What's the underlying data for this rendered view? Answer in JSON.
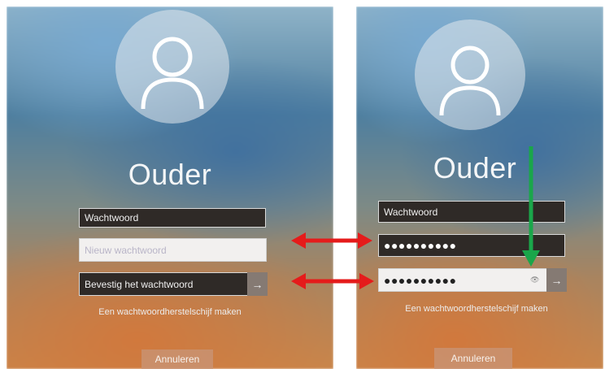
{
  "left": {
    "username": "Ouder",
    "password_field_value": "Wachtwoord",
    "new_password_placeholder": "Nieuw wachtwoord",
    "confirm_password_value": "Bevestig het wachtwoord",
    "submit_arrow": "→",
    "reset_disk_link": "Een wachtwoordherstelschijf maken",
    "cancel_label": "Annuleren"
  },
  "right": {
    "username": "Ouder",
    "password_field_value": "Wachtwoord",
    "new_password_masked": "●●●●●●●●●●",
    "confirm_password_masked": "●●●●●●●●●●",
    "reveal_icon": "👁",
    "submit_arrow": "→",
    "reset_disk_link": "Een wachtwoordherstelschijf maken",
    "cancel_label": "Annuleren"
  },
  "annotation_colors": {
    "double_arrow": "#e51b1b",
    "down_arrow": "#1aa64a"
  }
}
